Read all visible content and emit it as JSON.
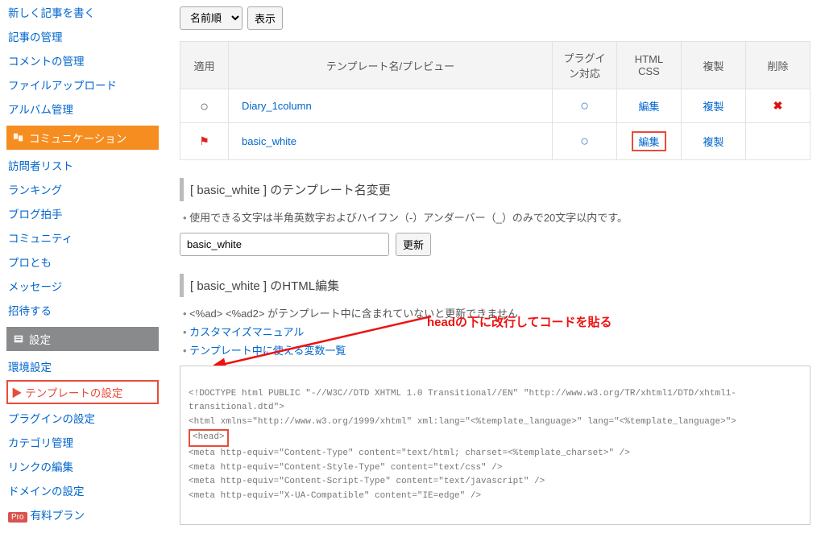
{
  "sidebar": {
    "group1": [
      "新しく記事を書く",
      "記事の管理",
      "コメントの管理",
      "ファイルアップロード",
      "アルバム管理"
    ],
    "comm_header": "コミュニケーション",
    "group2": [
      "訪問者リスト",
      "ランキング",
      "ブログ拍手",
      "コミュニティ",
      "プロとも",
      "メッセージ",
      "招待する"
    ],
    "settings_header": "設定",
    "group3": [
      "環境設定",
      "テンプレートの設定",
      "プラグインの設定",
      "カテゴリ管理",
      "リンクの編集",
      "ドメインの設定"
    ],
    "pro_label": "Pro",
    "paid_plan": "有料プラン"
  },
  "top": {
    "sort_label": "名前順",
    "show_btn": "表示"
  },
  "table": {
    "headers": {
      "apply": "適用",
      "name": "テンプレート名/プレビュー",
      "plugin": "プラグイン対応",
      "htmlcss_l1": "HTML",
      "htmlcss_l2": "CSS",
      "dup": "複製",
      "del": "削除"
    },
    "rows": [
      {
        "apply_type": "circle",
        "name": "Diary_1column",
        "plugin_ok": true,
        "edit": "編集",
        "dup": "複製",
        "del": true,
        "highlight_edit": false
      },
      {
        "apply_type": "flag",
        "name": "basic_white",
        "plugin_ok": true,
        "edit": "編集",
        "dup": "複製",
        "del": false,
        "highlight_edit": true
      }
    ]
  },
  "rename": {
    "title_prefix": "[ ",
    "title_name": "basic_white",
    "title_suffix": " ] のテンプレート名変更",
    "note": "使用できる文字は半角英数字およびハイフン（-）アンダーバー（_）のみで20文字以内です。",
    "input_value": "basic_white",
    "update_btn": "更新"
  },
  "htmledit": {
    "title_prefix": "[ ",
    "title_name": "basic_white",
    "title_suffix": " ] のHTML編集",
    "note1_pre": "<%ad> <%ad2> ",
    "note1_post": "がテンプレート中に含まれていないと更新できません",
    "link1": "カスタマイズマニュアル",
    "link2": "テンプレート中に使える変数一覧",
    "code_line1": "<!DOCTYPE html PUBLIC \"-//W3C//DTD XHTML 1.0 Transitional//EN\" \"http://www.w3.org/TR/xhtml1/DTD/xhtml1-transitional.dtd\">",
    "code_line2": "<html xmlns=\"http://www.w3.org/1999/xhtml\" xml:lang=\"<%template_language>\" lang=\"<%template_language>\">",
    "code_head": "<head>",
    "code_line3": "<meta http-equiv=\"Content-Type\" content=\"text/html; charset=<%template_charset>\" />",
    "code_line4": "<meta http-equiv=\"Content-Style-Type\" content=\"text/css\" />",
    "code_line5": "<meta http-equiv=\"Content-Script-Type\" content=\"text/javascript\" />",
    "code_line6": "<meta http-equiv=\"X-UA-Compatible\" content=\"IE=edge\" />"
  },
  "annotation": "headの下に改行してコードを貼る"
}
